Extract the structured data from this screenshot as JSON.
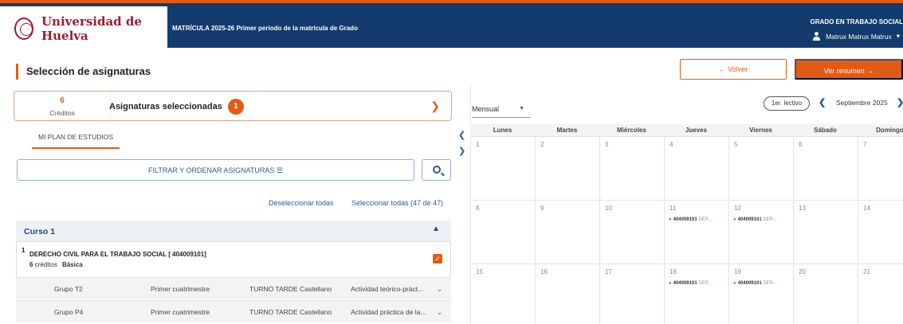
{
  "header": {
    "university": "Universidad de Huelva",
    "enrollment_title": "MATRÍCULA 2025-26 Primer periodo de la matrícula de Grado",
    "degree": "GRADO EN TRABAJO SOCIAL",
    "user": "Matrux Matrux Matrux"
  },
  "page": {
    "title": "Selección de asignaturas",
    "back_label": "← Volver",
    "summary_label": "Ver resumen →"
  },
  "selected": {
    "credits": "6",
    "credits_label": "Créditos",
    "label": "Asignaturas seleccionadas",
    "count": "1"
  },
  "tabs": {
    "plan": "MI PLAN DE ESTUDIOS"
  },
  "filter": {
    "label": "FILTRAR Y ORDENAR ASIGNATURAS ☰"
  },
  "links": {
    "deselect_all": "Deseleccionar todas",
    "select_all": "Seleccionar todas (47 de 47)"
  },
  "course": {
    "title": "Curso 1",
    "subject": {
      "num": "1",
      "name": "DERECHO CIVIL PARA EL TRABAJO SOCIAL [ 404009101]",
      "credits": "6",
      "credits_label": "créditos",
      "type": "Básica"
    },
    "groups": [
      {
        "name": "Grupo T2",
        "semester": "Primer cuatrimestre",
        "turno": "TURNO TARDE  Castellano",
        "activity": "Actividad teórico-práct..."
      },
      {
        "name": "Grupo P4",
        "semester": "Primer cuatrimestre",
        "turno": "TURNO TARDE  Castellano",
        "activity": "Actividad práctica de la..."
      }
    ]
  },
  "calendar": {
    "view": "Mensual",
    "lectivo": "1er. lectivo",
    "month": "Septiembre 2025",
    "weekdays": [
      "Lunes",
      "Martes",
      "Miércoles",
      "Jueves",
      "Viernes",
      "Sábado",
      "Domingo"
    ],
    "weeks": [
      [
        "1",
        "2",
        "3",
        "4",
        "5",
        "6",
        "7"
      ],
      [
        "8",
        "9",
        "10",
        "11",
        "12",
        "13",
        "14"
      ],
      [
        "15",
        "16",
        "17",
        "18",
        "19",
        "20",
        "21"
      ]
    ],
    "event_code": "404009101",
    "event_rest": "DER..."
  },
  "icons": {
    "user": "user-icon",
    "search": "search-icon",
    "chevron": "chevron-down-icon",
    "check": "checkbox-checked-icon"
  },
  "colors": {
    "header_bg": "#143b6d",
    "accent": "#e25b16",
    "link": "#2a5b92"
  }
}
